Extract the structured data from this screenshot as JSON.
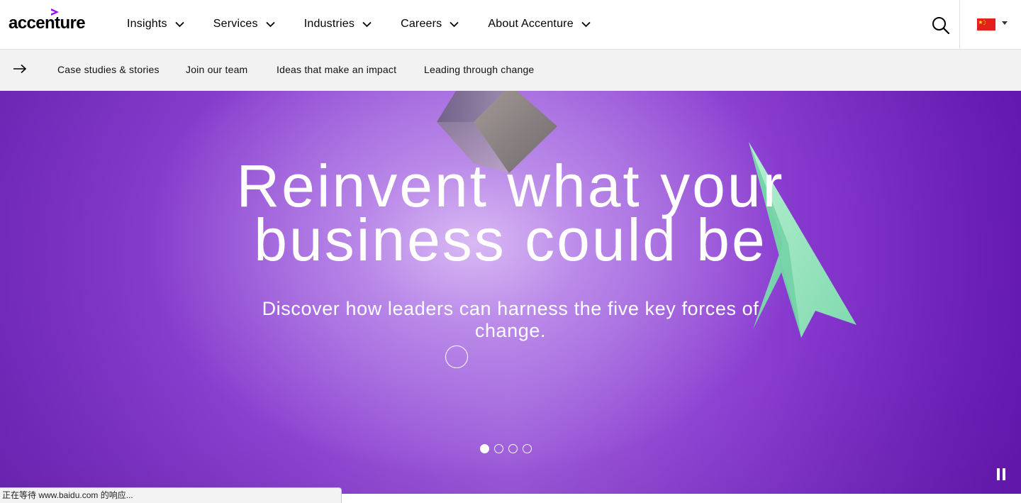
{
  "brand": {
    "name": "accenture",
    "accent_color": "#a100ff"
  },
  "header": {
    "nav": [
      {
        "label": "Insights",
        "icon": "chevron-down-icon"
      },
      {
        "label": "Services",
        "icon": "chevron-down-icon"
      },
      {
        "label": "Industries",
        "icon": "chevron-down-icon"
      },
      {
        "label": "Careers",
        "icon": "chevron-down-icon"
      },
      {
        "label": "About Accenture",
        "icon": "chevron-down-icon"
      }
    ],
    "search_icon": "search-icon",
    "language": {
      "flag": "china-flag-icon",
      "icon": "caret-down-icon"
    }
  },
  "subnav": {
    "arrow_icon": "arrow-right-icon",
    "links": [
      {
        "label": "Case studies & stories"
      },
      {
        "label": "Join our team"
      },
      {
        "label": "Ideas that make an impact"
      },
      {
        "label": "Leading through change"
      }
    ]
  },
  "hero": {
    "headline_line1": "Reinvent what your",
    "headline_line2": "business could be",
    "subheadline": "Discover how leaders can harness the five key forces of change.",
    "play_icon": "play-circle-icon",
    "carousel": {
      "total": 4,
      "active": 1
    },
    "pause_icon": "pause-icon",
    "colors": {
      "primary": "#8e45d2",
      "highlight": "#c89ef0",
      "plane": "#8fe0b8"
    }
  },
  "status_bar": {
    "text": "正在等待 www.baidu.com 的响应..."
  }
}
